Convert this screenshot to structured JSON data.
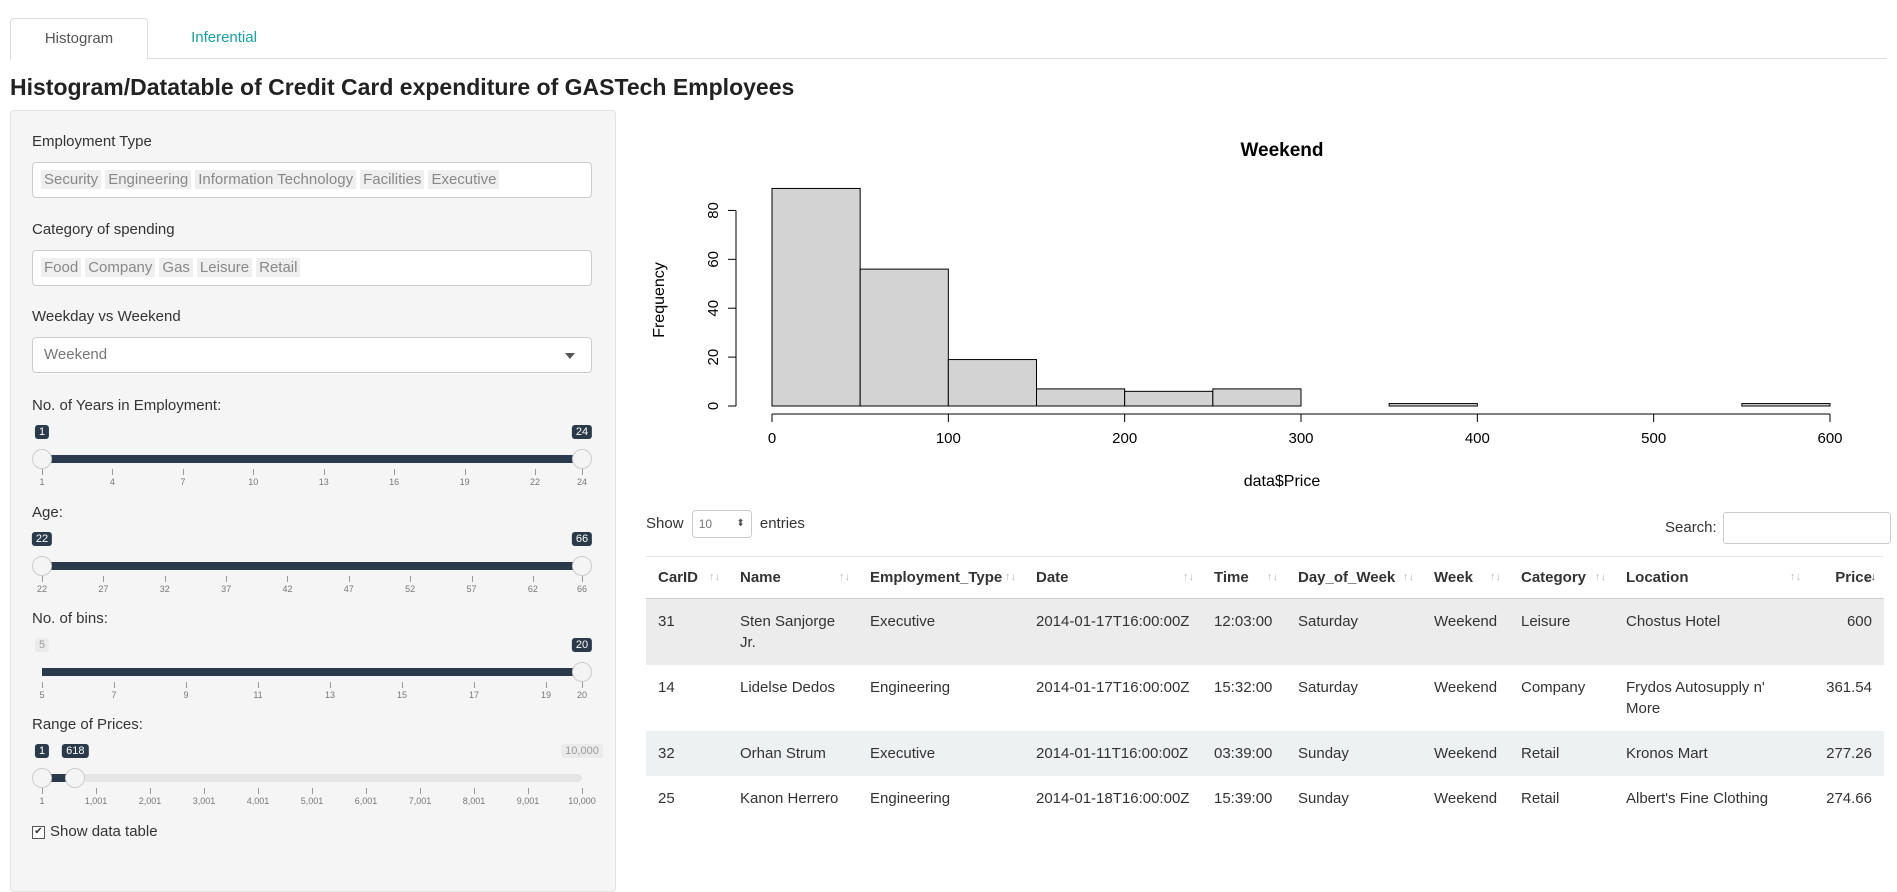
{
  "tabs": [
    "Histogram",
    "Inferential"
  ],
  "title": "Histogram/Datatable of Credit Card expenditure of GASTech Employees",
  "filters": {
    "employment": {
      "label": "Employment Type",
      "chips": [
        "Security",
        "Engineering",
        "Information Technology",
        "Facilities",
        "Executive"
      ]
    },
    "category": {
      "label": "Category of spending",
      "chips": [
        "Food",
        "Company",
        "Gas",
        "Leisure",
        "Retail"
      ]
    },
    "weekday": {
      "label": "Weekday vs Weekend",
      "value": "Weekend"
    }
  },
  "sliders": {
    "years": {
      "label": "No. of Years in Employment:",
      "min": 1,
      "max": 24,
      "from": 1,
      "to": 24,
      "from_label": "1",
      "to_label": "24",
      "ticks": [
        "1",
        "4",
        "7",
        "10",
        "13",
        "16",
        "19",
        "22",
        "24"
      ],
      "tick_values": [
        1,
        4,
        7,
        10,
        13,
        16,
        19,
        22,
        24
      ]
    },
    "age": {
      "label": "Age:",
      "min": 22,
      "max": 66,
      "from": 22,
      "to": 66,
      "from_label": "22",
      "to_label": "66",
      "ticks": [
        "22",
        "27",
        "32",
        "37",
        "42",
        "47",
        "52",
        "57",
        "62",
        "66"
      ],
      "tick_values": [
        22,
        27,
        32,
        37,
        42,
        47,
        52,
        57,
        62,
        66
      ]
    },
    "bins": {
      "label": "No. of bins:",
      "min": 5,
      "max": 20,
      "value": 20,
      "min_label": "5",
      "value_label": "20",
      "ticks": [
        "5",
        "7",
        "9",
        "11",
        "13",
        "15",
        "17",
        "19",
        "20"
      ],
      "tick_values": [
        5,
        7,
        9,
        11,
        13,
        15,
        17,
        19,
        20
      ]
    },
    "prices": {
      "label": "Range of Prices:",
      "min": 1,
      "max": 10000,
      "from": 1,
      "to": 618,
      "from_label": "1",
      "to_label": "618",
      "max_label": "10,000",
      "ticks": [
        "1",
        "1,001",
        "2,001",
        "3,001",
        "4,001",
        "5,001",
        "6,001",
        "7,001",
        "8,001",
        "9,001",
        "10,000"
      ],
      "tick_values": [
        1,
        1001,
        2001,
        3001,
        4001,
        5001,
        6001,
        7001,
        8001,
        9001,
        10000
      ]
    }
  },
  "show_table": {
    "label": "Show data table",
    "checked": true
  },
  "chart_data": {
    "type": "bar",
    "title": "Weekend",
    "xlabel": "data$Price",
    "ylabel": "Frequency",
    "bins": [
      [
        0,
        50
      ],
      [
        50,
        100
      ],
      [
        100,
        150
      ],
      [
        150,
        200
      ],
      [
        200,
        250
      ],
      [
        250,
        300
      ],
      [
        300,
        350
      ],
      [
        350,
        400
      ],
      [
        400,
        450
      ],
      [
        450,
        500
      ],
      [
        500,
        550
      ],
      [
        550,
        600
      ]
    ],
    "values": [
      89,
      56,
      19,
      7,
      6,
      7,
      0,
      1,
      0,
      0,
      0,
      1
    ],
    "xlim": [
      0,
      600
    ],
    "ylim": [
      0,
      90
    ],
    "xticks": [
      0,
      100,
      200,
      300,
      400,
      500,
      600
    ],
    "yticks": [
      0,
      20,
      40,
      60,
      80
    ]
  },
  "table": {
    "show_label": "Show",
    "length_value": "10",
    "entries_label": "entries",
    "search_label": "Search:",
    "columns": [
      "CarID",
      "Name",
      "Employment_Type",
      "Date",
      "Time",
      "Day_of_Week",
      "Week",
      "Category",
      "Location",
      "Price"
    ],
    "rows": [
      [
        "31",
        "Sten Sanjorge Jr.",
        "Executive",
        "2014-01-17T16:00:00Z",
        "12:03:00",
        "Saturday",
        "Weekend",
        "Leisure",
        "Chostus Hotel",
        "600"
      ],
      [
        "14",
        "Lidelse Dedos",
        "Engineering",
        "2014-01-17T16:00:00Z",
        "15:32:00",
        "Saturday",
        "Weekend",
        "Company",
        "Frydos Autosupply n' More",
        "361.54"
      ],
      [
        "32",
        "Orhan Strum",
        "Executive",
        "2014-01-11T16:00:00Z",
        "03:39:00",
        "Sunday",
        "Weekend",
        "Retail",
        "Kronos Mart",
        "277.26"
      ],
      [
        "25",
        "Kanon Herrero",
        "Engineering",
        "2014-01-18T16:00:00Z",
        "15:39:00",
        "Sunday",
        "Weekend",
        "Retail",
        "Albert's Fine Clothing",
        "274.66"
      ]
    ]
  }
}
